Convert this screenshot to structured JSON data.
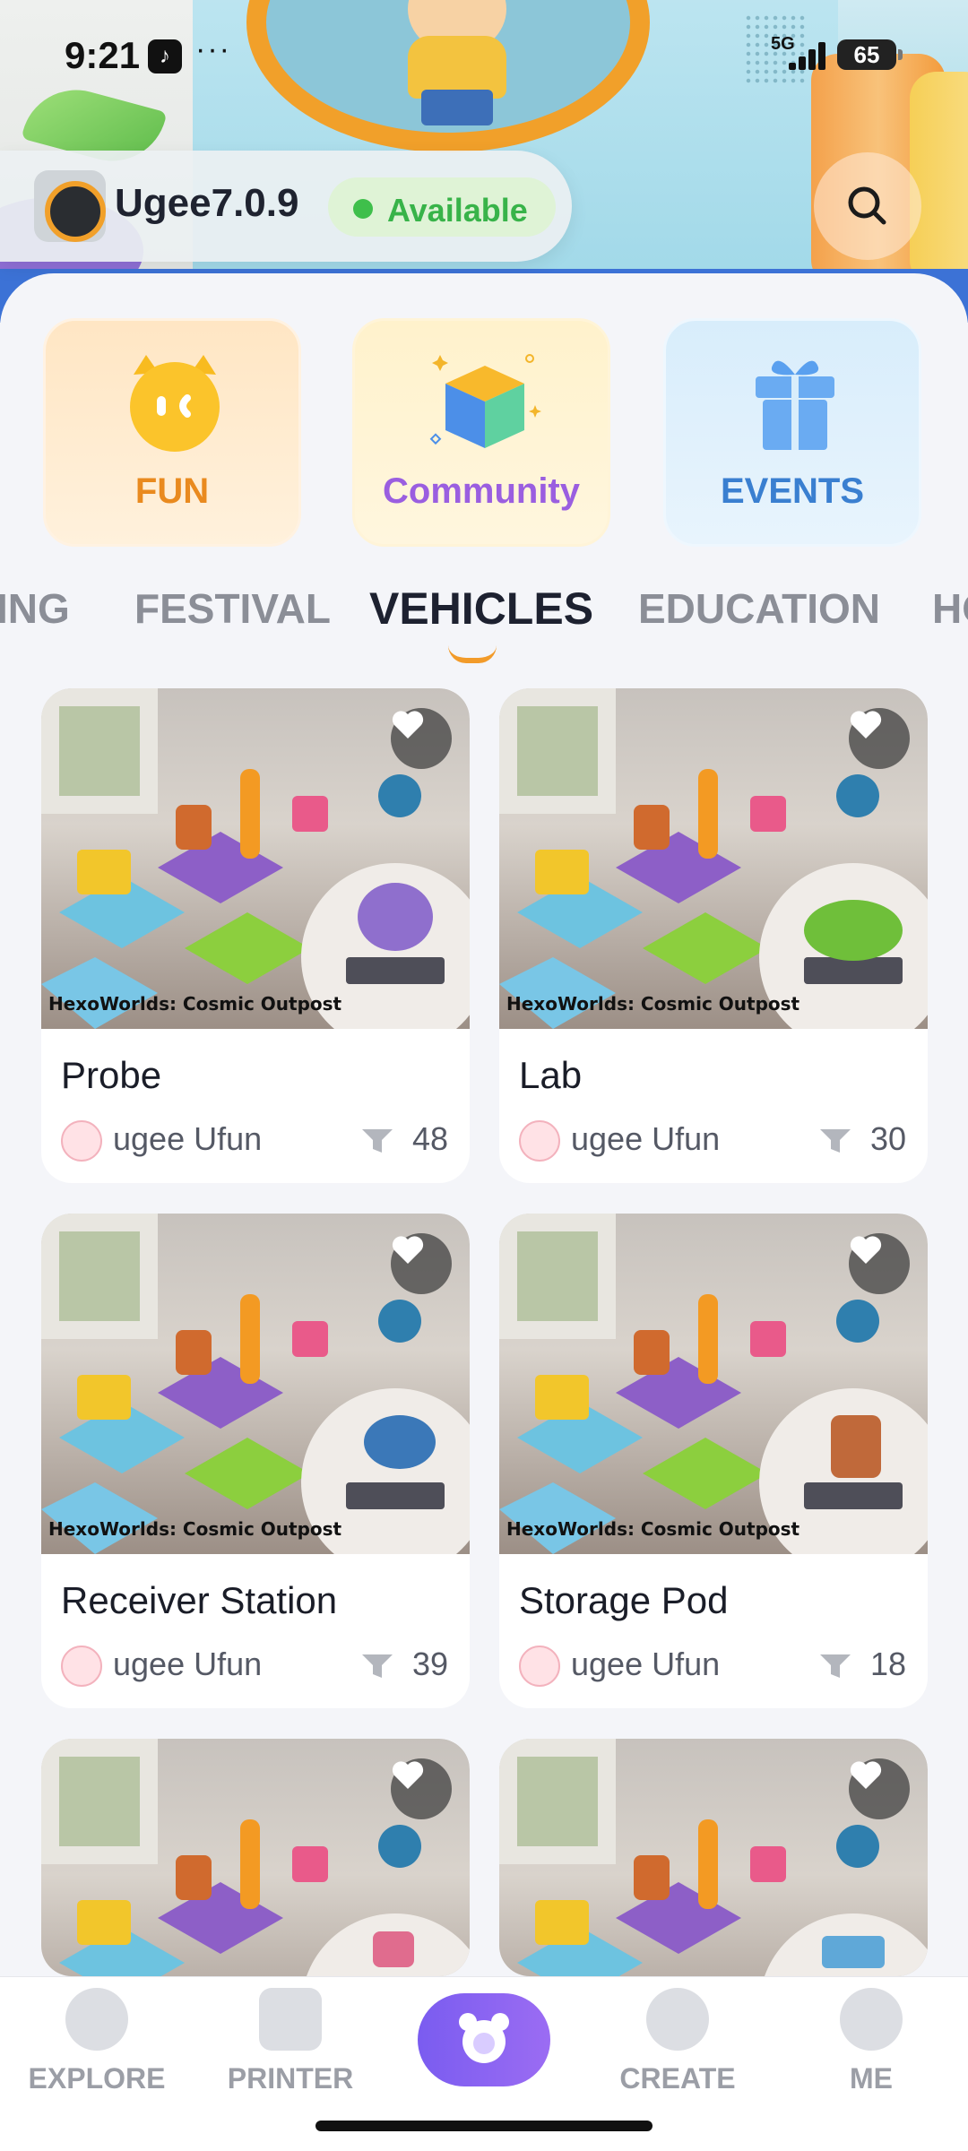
{
  "status_bar": {
    "time": "9:21",
    "app_icon": "tiktok-icon",
    "more": "···",
    "network": "5G",
    "battery": "65"
  },
  "device": {
    "name": "Ugee7.0.9",
    "status": "Available",
    "status_color": "#3fbf4b"
  },
  "categories": [
    {
      "label": "FUN",
      "icon": "fun-cat-icon",
      "color": "#e98a1f"
    },
    {
      "label": "Community",
      "icon": "community-cube-icon",
      "color": "#9a5ee0"
    },
    {
      "label": "EVENTS",
      "icon": "gift-icon",
      "color": "#3a7fd0"
    }
  ],
  "tabs": {
    "items": [
      "ING",
      "FESTIVAL",
      "VEHICLES",
      "EDUCATION",
      "HO"
    ],
    "active": "VEHICLES"
  },
  "cards": [
    {
      "image_title": "HexoWorlds: Cosmic Outpost",
      "title": "Probe",
      "author": "ugee Ufun",
      "downloads": "48"
    },
    {
      "image_title": "HexoWorlds: Cosmic Outpost",
      "title": "Lab",
      "author": "ugee Ufun",
      "downloads": "30"
    },
    {
      "image_title": "HexoWorlds: Cosmic Outpost",
      "title": "Receiver Station",
      "author": "ugee Ufun",
      "downloads": "39"
    },
    {
      "image_title": "HexoWorlds: Cosmic Outpost",
      "title": "Storage Pod",
      "author": "ugee Ufun",
      "downloads": "18"
    },
    {
      "image_title": "",
      "title": "",
      "author": "",
      "downloads": ""
    },
    {
      "image_title": "",
      "title": "",
      "author": "",
      "downloads": ""
    }
  ],
  "bottom_nav": {
    "items": [
      "EXPLORE",
      "PRINTER",
      "",
      "CREATE",
      "ME"
    ]
  },
  "colors": {
    "accent": "#7a5cf0",
    "tab_indicator": "#f29b2a",
    "available_green": "#38b349"
  }
}
